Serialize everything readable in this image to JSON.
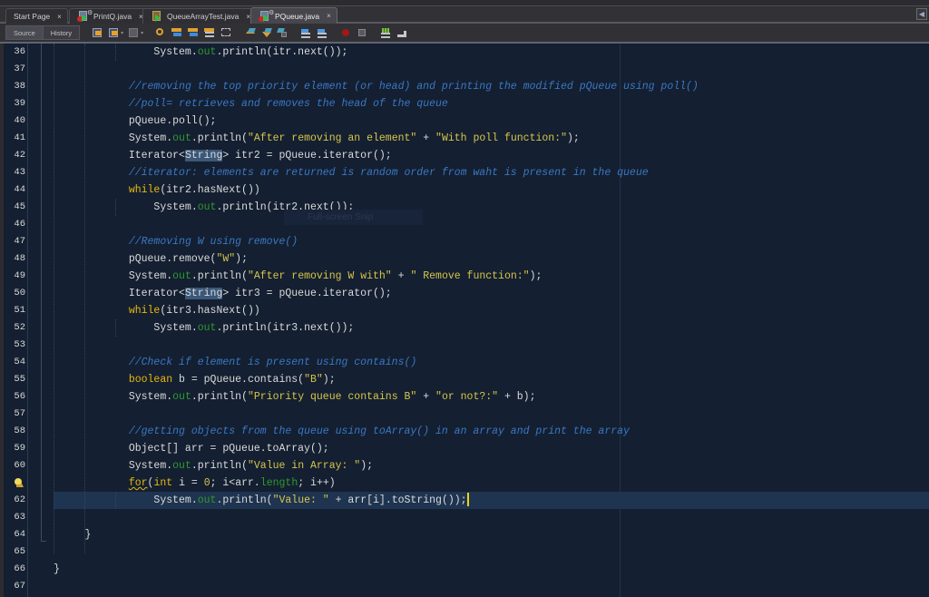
{
  "tabs": [
    {
      "label": "Start Page",
      "active": false,
      "icon": "none"
    },
    {
      "label": "PrintQ.java",
      "active": false,
      "icon": "java-runnable-file-icon"
    },
    {
      "label": "QueueArrayTest.java",
      "active": false,
      "icon": "java-class-file-icon"
    },
    {
      "label": "PQueue.java",
      "active": true,
      "icon": "java-runnable-file-icon"
    }
  ],
  "close_glyph": "×",
  "scroll_glyph": "◀",
  "toolbar": {
    "source_label": "Source",
    "history_label": "History",
    "icons": [
      "last-edit-icon",
      "back-icon",
      "forward-icon",
      "find-selection-icon",
      "find-previous-icon",
      "find-next-icon",
      "toggle-highlight-icon",
      "toggle-rect-select-icon",
      "previous-bookmark-icon",
      "next-bookmark-icon",
      "toggle-bookmark-icon",
      "shift-left-icon",
      "shift-right-icon",
      "start-macro-icon",
      "stop-macro-icon",
      "comment-icon",
      "uncomment-icon"
    ]
  },
  "colors": {
    "editor_bg": "#141f31",
    "keyword": "#e8b80c",
    "string": "#d6c64a",
    "comment": "#3a78c4",
    "field": "#2e9a2e",
    "current_line": "#1e3450"
  },
  "tooltip": "Full-screen Snip",
  "editor": {
    "current_line": 62,
    "lines": [
      {
        "n": "36",
        "tokens": [
          {
            "t": "        System."
          },
          {
            "t": "out",
            "c": "out"
          },
          {
            "t": ".println(itr.next());"
          }
        ]
      },
      {
        "n": "37",
        "tokens": []
      },
      {
        "n": "38",
        "tokens": [
          {
            "t": "    "
          },
          {
            "t": "//removing the top priority element (or head) and printing the modified pQueue using poll()",
            "c": "cm"
          }
        ]
      },
      {
        "n": "39",
        "tokens": [
          {
            "t": "    "
          },
          {
            "t": "//poll= retrieves and removes the head of the queue",
            "c": "cm"
          }
        ]
      },
      {
        "n": "40",
        "tokens": [
          {
            "t": "    pQueue.poll();"
          }
        ]
      },
      {
        "n": "41",
        "tokens": [
          {
            "t": "    System."
          },
          {
            "t": "out",
            "c": "out"
          },
          {
            "t": ".println("
          },
          {
            "t": "\"After removing an element\"",
            "c": "str"
          },
          {
            "t": " + "
          },
          {
            "t": "\"With poll function:\"",
            "c": "str"
          },
          {
            "t": ");"
          }
        ]
      },
      {
        "n": "42",
        "tokens": [
          {
            "t": "    Iterator<"
          },
          {
            "t": "String",
            "c": "hl"
          },
          {
            "t": "> itr2 = pQueue.iterator();"
          }
        ]
      },
      {
        "n": "43",
        "tokens": [
          {
            "t": "    "
          },
          {
            "t": "//iterator: elements are returned is random order from waht is present in the queue",
            "c": "cm"
          }
        ]
      },
      {
        "n": "44",
        "tokens": [
          {
            "t": "    "
          },
          {
            "t": "while",
            "c": "kw"
          },
          {
            "t": "(itr2.hasNext())"
          }
        ]
      },
      {
        "n": "45",
        "tokens": [
          {
            "t": "        System."
          },
          {
            "t": "out",
            "c": "out"
          },
          {
            "t": ".println(itr2.next());"
          }
        ]
      },
      {
        "n": "46",
        "tokens": []
      },
      {
        "n": "47",
        "tokens": [
          {
            "t": "    "
          },
          {
            "t": "//Removing W using remove()",
            "c": "cm"
          }
        ]
      },
      {
        "n": "48",
        "tokens": [
          {
            "t": "    pQueue.remove("
          },
          {
            "t": "\"W\"",
            "c": "str"
          },
          {
            "t": ");"
          }
        ]
      },
      {
        "n": "49",
        "tokens": [
          {
            "t": "    System."
          },
          {
            "t": "out",
            "c": "out"
          },
          {
            "t": ".println("
          },
          {
            "t": "\"After removing W with\"",
            "c": "str"
          },
          {
            "t": " + "
          },
          {
            "t": "\" Remove function:\"",
            "c": "str"
          },
          {
            "t": ");"
          }
        ]
      },
      {
        "n": "50",
        "tokens": [
          {
            "t": "    Iterator<"
          },
          {
            "t": "String",
            "c": "hl"
          },
          {
            "t": "> itr3 = pQueue.iterator();"
          }
        ]
      },
      {
        "n": "51",
        "tokens": [
          {
            "t": "    "
          },
          {
            "t": "while",
            "c": "kw"
          },
          {
            "t": "(itr3.hasNext())"
          }
        ]
      },
      {
        "n": "52",
        "tokens": [
          {
            "t": "        System."
          },
          {
            "t": "out",
            "c": "out"
          },
          {
            "t": ".println(itr3.next());"
          }
        ]
      },
      {
        "n": "53",
        "tokens": []
      },
      {
        "n": "54",
        "tokens": [
          {
            "t": "    "
          },
          {
            "t": "//Check if element is present using contains()",
            "c": "cm"
          }
        ]
      },
      {
        "n": "55",
        "tokens": [
          {
            "t": "    "
          },
          {
            "t": "boolean",
            "c": "kw"
          },
          {
            "t": " b = pQueue.contains("
          },
          {
            "t": "\"B\"",
            "c": "str"
          },
          {
            "t": ");"
          }
        ]
      },
      {
        "n": "56",
        "tokens": [
          {
            "t": "    System."
          },
          {
            "t": "out",
            "c": "out"
          },
          {
            "t": ".println("
          },
          {
            "t": "\"Priority queue contains B\"",
            "c": "str"
          },
          {
            "t": " + "
          },
          {
            "t": "\"or not?:\"",
            "c": "str"
          },
          {
            "t": " + b);"
          }
        ]
      },
      {
        "n": "57",
        "tokens": []
      },
      {
        "n": "58",
        "tokens": [
          {
            "t": "    "
          },
          {
            "t": "//getting objects from the queue using toArray() in an array and print the array",
            "c": "cm"
          }
        ]
      },
      {
        "n": "59",
        "tokens": [
          {
            "t": "    Object[] arr = pQueue.toArray();"
          }
        ]
      },
      {
        "n": "60",
        "tokens": [
          {
            "t": "    System."
          },
          {
            "t": "out",
            "c": "out"
          },
          {
            "t": ".println("
          },
          {
            "t": "\"Value in Array: \"",
            "c": "str"
          },
          {
            "t": ");"
          }
        ]
      },
      {
        "n": "",
        "hint": true,
        "tokens": [
          {
            "t": "    "
          },
          {
            "t": "for",
            "c": "kw squig"
          },
          {
            "t": "("
          },
          {
            "t": "int",
            "c": "kw"
          },
          {
            "t": " i = "
          },
          {
            "t": "0",
            "c": "str"
          },
          {
            "t": "; i<arr."
          },
          {
            "t": "length",
            "c": "out"
          },
          {
            "t": "; i++)"
          }
        ]
      },
      {
        "n": "62",
        "current": true,
        "tokens": [
          {
            "t": "        System."
          },
          {
            "t": "out",
            "c": "out"
          },
          {
            "t": ".println("
          },
          {
            "t": "\"Value: \"",
            "c": "str"
          },
          {
            "t": " + arr[i].toString());"
          }
        ]
      },
      {
        "n": "63",
        "tokens": []
      },
      {
        "n": "64",
        "tokens": [
          {
            "t": "  }"
          }
        ]
      },
      {
        "n": "65",
        "tokens": []
      },
      {
        "n": "66",
        "tokens": [
          {
            "t": "}"
          }
        ]
      },
      {
        "n": "67",
        "tokens": []
      }
    ]
  }
}
